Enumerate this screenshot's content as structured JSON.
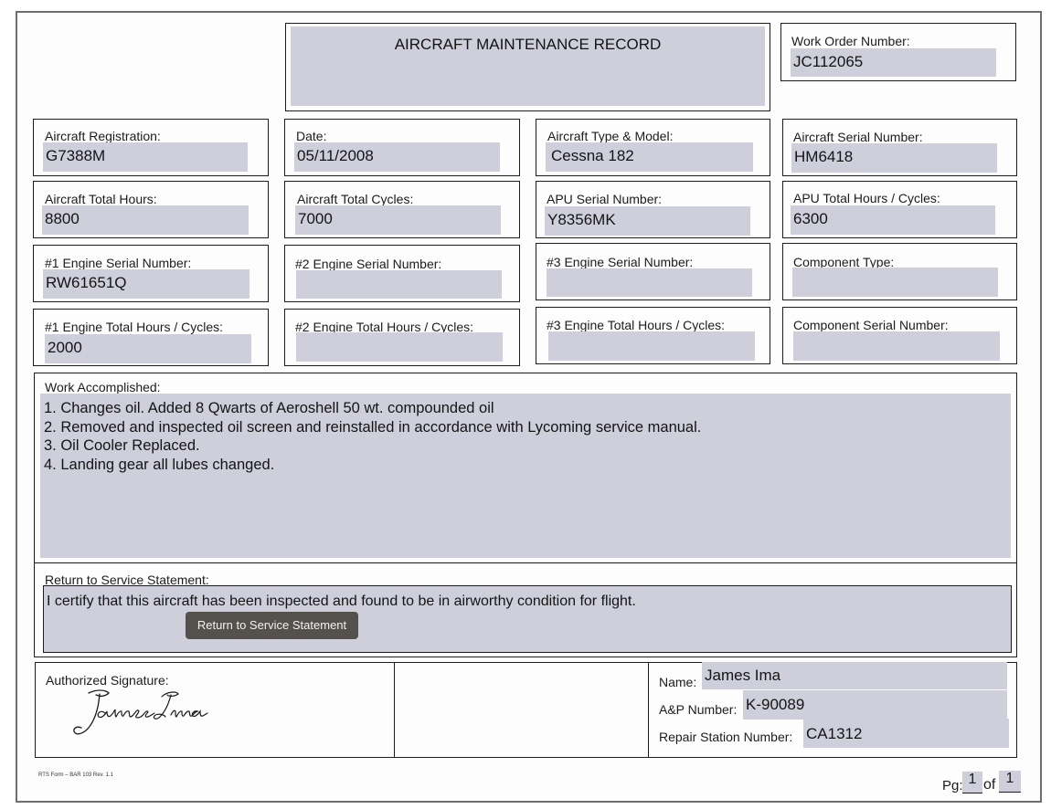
{
  "form": {
    "title": "AIRCRAFT MAINTENANCE RECORD",
    "work_order": {
      "label": "Work Order Number:",
      "value": "JC112065"
    },
    "registration": {
      "label": "Aircraft Registration:",
      "value": "G7388M"
    },
    "date": {
      "label": "Date:",
      "value": "05/11/2008"
    },
    "type_model": {
      "label": "Aircraft Type & Model:",
      "value": "Cessna 182"
    },
    "serial": {
      "label": "Aircraft Serial Number:",
      "value": "HM6418"
    },
    "total_hours": {
      "label": "Aircraft Total Hours:",
      "value": "8800"
    },
    "total_cycles": {
      "label": "Aircraft Total Cycles:",
      "value": "7000"
    },
    "apu_serial": {
      "label": "APU Serial Number:",
      "value": "Y8356MK"
    },
    "apu_hours": {
      "label": "APU Total Hours / Cycles:",
      "value": "6300"
    },
    "eng1_serial": {
      "label": "#1 Engine Serial Number:",
      "value": "RW61651Q"
    },
    "eng2_serial": {
      "label": "#2 Engine Serial Number:",
      "value": ""
    },
    "eng3_serial": {
      "label": "#3 Engine Serial Number:",
      "value": ""
    },
    "component_type": {
      "label": "Component Type:",
      "value": ""
    },
    "eng1_hours": {
      "label": "#1 Engine Total Hours / Cycles:",
      "value": "2000"
    },
    "eng2_hours": {
      "label": "#2 Engine Total Hours / Cycles:",
      "value": ""
    },
    "eng3_hours": {
      "label": "#3 Engine Total Hours / Cycles:",
      "value": ""
    },
    "component_serial": {
      "label": "Component Serial Number:",
      "value": ""
    },
    "work_accomplished": {
      "label": "Work Accomplished:",
      "lines": [
        "1. Changes oil. Added 8 Qwarts of Aeroshell 50 wt. compounded oil",
        "2. Removed and inspected oil screen and reinstalled in accordance with Lycoming service manual.",
        "3. Oil Cooler Replaced.",
        "4. Landing gear all lubes changed."
      ]
    },
    "rts": {
      "label": "Return to Service Statement:",
      "statement": "I certify that this aircraft has been inspected and found to be in airworthy condition for flight.",
      "button_label": "Return to Service Statement"
    },
    "signature": {
      "label": "Authorized Signature:",
      "signed_name": "James Ima"
    },
    "name": {
      "label": "Name:",
      "value": "James Ima"
    },
    "ap_number": {
      "label": "A&P Number:",
      "value": "K-90089"
    },
    "repair_station": {
      "label": "Repair Station Number:",
      "value": "CA1312"
    },
    "footer": {
      "form_code": "RTS Form – BAR 103 Rev. 1.1",
      "pg_label": "Pg:",
      "pg_current": "1",
      "of_label": "of",
      "pg_total": "1"
    }
  },
  "colors": {
    "field_fill": "#cfcfdc",
    "border": "#1c1c1c",
    "button": "#54504b"
  }
}
